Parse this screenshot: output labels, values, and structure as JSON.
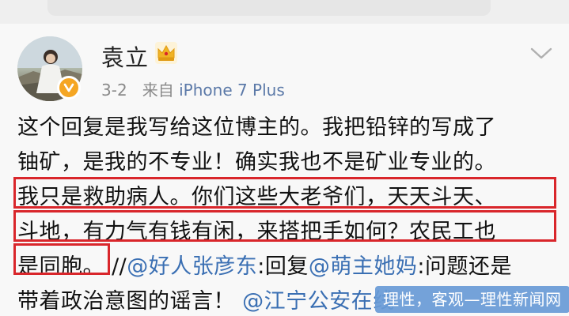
{
  "post": {
    "author": "袁立",
    "date": "3-2",
    "source_prefix": "来自",
    "source": "iPhone 7 Plus",
    "lines": [
      [
        {
          "t": "这个回复是我写给这位博主的。我把铅锌的写成了",
          "link": false
        }
      ],
      [
        {
          "t": "铀矿，是我的不专业！确实我也不是矿业专业的。",
          "link": false
        }
      ],
      [
        {
          "t": "我只是救助病人。你们这些大老爷们，天天斗天、",
          "link": false
        }
      ],
      [
        {
          "t": "斗地，有力气有钱有闲，来搭把手如何？农民工也",
          "link": false
        }
      ],
      [
        {
          "t": "是同胞。",
          "link": false
        },
        {
          "t": " //",
          "link": false
        },
        {
          "t": "@好人张彦东",
          "link": true
        },
        {
          "t": ":回复",
          "link": false
        },
        {
          "t": "@萌主她妈",
          "link": true
        },
        {
          "t": ":问题还是",
          "link": false
        }
      ],
      [
        {
          "t": "带着政治意图的谣言！ ",
          "link": false
        },
        {
          "t": "@江宁公安在线",
          "link": true
        }
      ]
    ]
  },
  "watermark": "理性，客观—理性新闻网",
  "icons": {
    "crown": "crown-icon",
    "verified": "verified-badge-icon",
    "more": "chevron-down-icon"
  },
  "colors": {
    "link": "#3a6fb3",
    "highlight_box": "#d9262b",
    "meta": "#8a8a8a",
    "watermark_bg": "#689ad6"
  }
}
